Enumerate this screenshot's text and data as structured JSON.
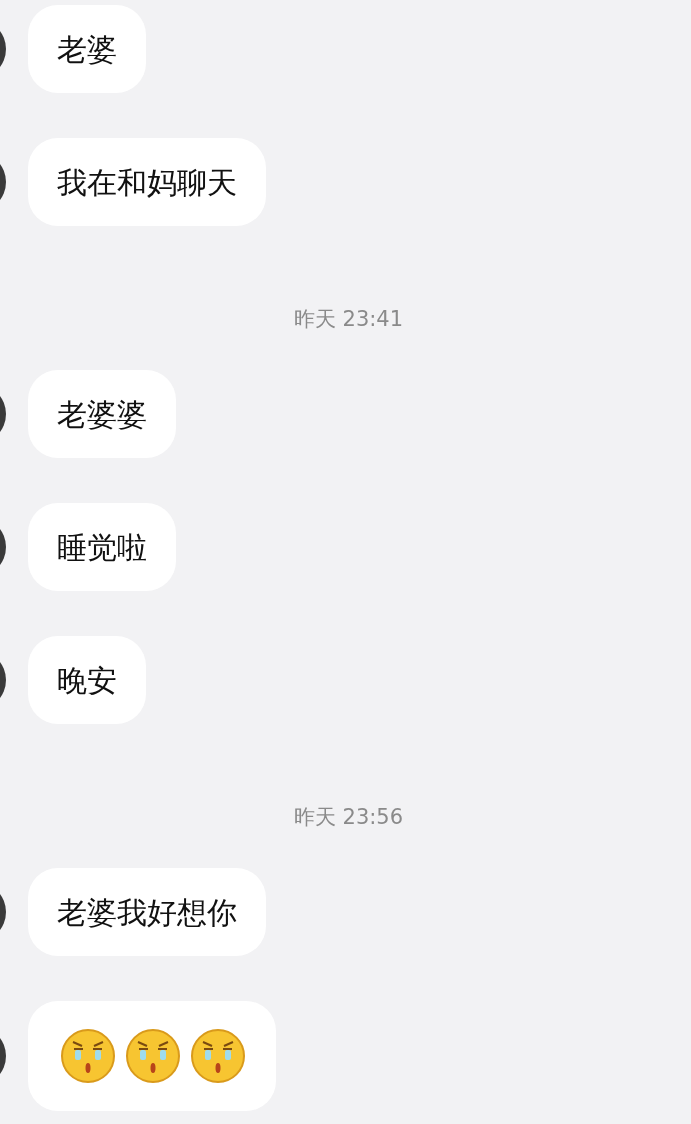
{
  "messages": [
    {
      "kind": "text",
      "text": "老婆"
    },
    {
      "kind": "text",
      "text": "我在和妈聊天"
    },
    {
      "kind": "time",
      "text": "昨天 23:41"
    },
    {
      "kind": "text",
      "text": "老婆婆"
    },
    {
      "kind": "text",
      "text": "睡觉啦"
    },
    {
      "kind": "text",
      "text": "晚安"
    },
    {
      "kind": "time",
      "text": "昨天 23:56"
    },
    {
      "kind": "text",
      "text": "老婆我好想你"
    },
    {
      "kind": "emoji",
      "emojis": [
        {
          "kind": "crying"
        },
        {
          "kind": "crying"
        },
        {
          "kind": "crying"
        }
      ]
    }
  ]
}
